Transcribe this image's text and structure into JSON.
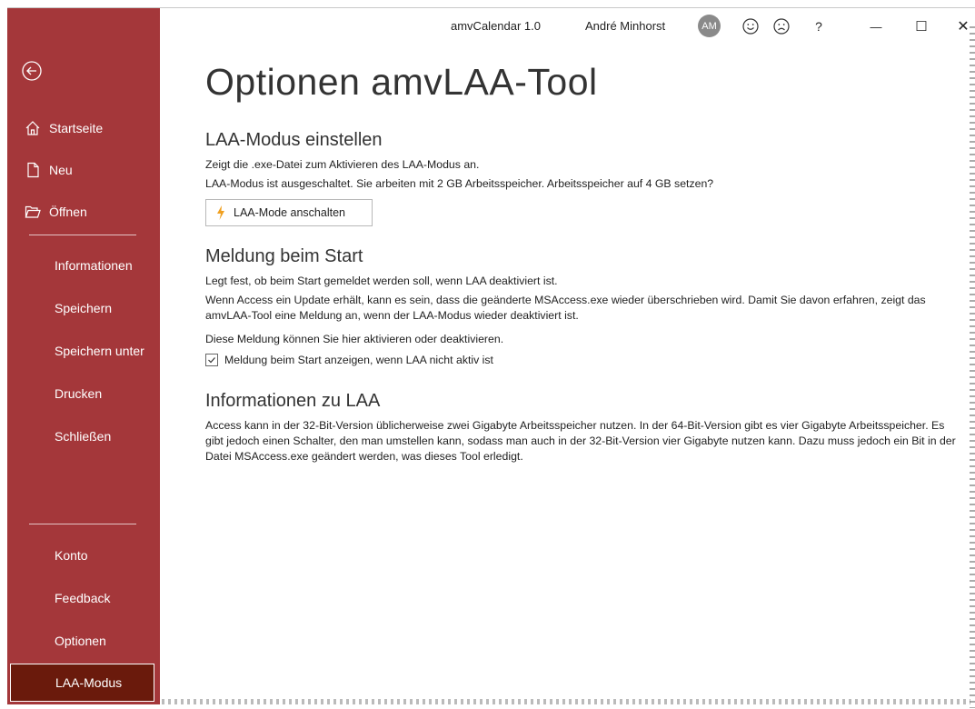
{
  "titlebar": {
    "app_title": "amvCalendar 1.0",
    "user_name": "André Minhorst",
    "avatar_initials": "AM",
    "help": "?",
    "minimize": "—",
    "maximize": "☐",
    "close": "✕"
  },
  "sidebar": {
    "top_items": [
      {
        "label": "Startseite",
        "icon": "home-icon"
      },
      {
        "label": "Neu",
        "icon": "new-file-icon"
      },
      {
        "label": "Öffnen",
        "icon": "open-folder-icon"
      }
    ],
    "items": [
      {
        "label": "Informationen"
      },
      {
        "label": "Speichern"
      },
      {
        "label": "Speichern unter"
      },
      {
        "label": "Drucken"
      },
      {
        "label": "Schließen"
      }
    ],
    "bottom_items": [
      {
        "label": "Konto"
      },
      {
        "label": "Feedback"
      },
      {
        "label": "Optionen"
      },
      {
        "label": "LAA-Modus",
        "active": true
      }
    ]
  },
  "main": {
    "title": "Optionen amvLAA-Tool",
    "section1": {
      "heading": "LAA-Modus einstellen",
      "line1": "Zeigt die .exe-Datei zum Aktivieren des LAA-Modus an.",
      "line2": "LAA-Modus ist ausgeschaltet. Sie arbeiten mit 2 GB Arbeitsspeicher. Arbeitsspeicher auf 4 GB setzen?",
      "button_label": "LAA-Mode anschalten"
    },
    "section2": {
      "heading": "Meldung beim Start",
      "line1": "Legt fest, ob beim Start gemeldet werden soll, wenn LAA deaktiviert ist.",
      "line2": "Wenn Access ein Update erhält, kann es sein, dass die geänderte MSAccess.exe wieder überschrieben wird. Damit Sie davon erfahren, zeigt das amvLAA-Tool eine Meldung an, wenn der LAA-Modus wieder deaktiviert ist.",
      "line3": "Diese Meldung können Sie hier aktivieren oder deaktivieren.",
      "checkbox_label": "Meldung beim Start anzeigen, wenn LAA nicht aktiv ist",
      "checkbox_checked": true
    },
    "section3": {
      "heading": "Informationen zu LAA",
      "text": "Access kann in der 32-Bit-Version üblicherweise zwei Gigabyte Arbeitsspeicher nutzen. In der 64-Bit-Version gibt es vier Gigabyte Arbeitsspeicher. Es gibt jedoch einen Schalter, den man umstellen kann, sodass man auch in der 32-Bit-Version vier Gigabyte nutzen kann. Dazu muss jedoch ein Bit in der Datei MSAccess.exe geändert werden, was dieses Tool erledigt."
    }
  },
  "colors": {
    "sidebar_bg": "#a4373a",
    "active_bg": "#6a1a0c",
    "bolt": "#f0a020"
  }
}
